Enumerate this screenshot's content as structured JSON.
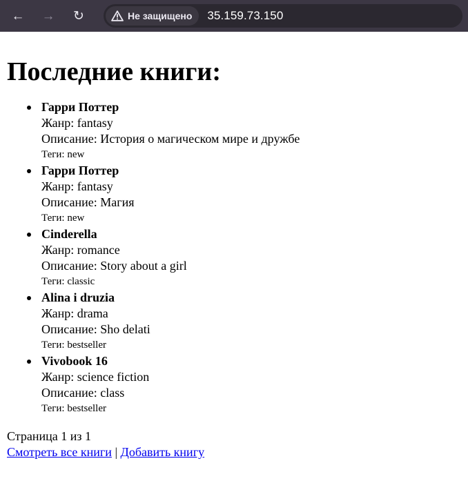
{
  "browser": {
    "security_label": "Не защищено",
    "url": "35.159.73.150",
    "icons": {
      "back": "back-arrow-icon",
      "forward": "forward-arrow-icon",
      "reload": "reload-icon",
      "security": "warning-triangle-icon"
    }
  },
  "page": {
    "heading": "Последние книги:",
    "books": [
      {
        "title": "Гарри Поттер",
        "genre": "Жанр: fantasy",
        "description": "Описание: История о магическом мире и дружбе",
        "tags": "Теги: new"
      },
      {
        "title": "Гарри Поттер",
        "genre": "Жанр: fantasy",
        "description": "Описание: Магия",
        "tags": "Теги: new"
      },
      {
        "title": "Cinderella",
        "genre": "Жанр: romance",
        "description": "Описание: Story about a girl",
        "tags": "Теги: classic"
      },
      {
        "title": "Alina i druzia",
        "genre": "Жанр: drama",
        "description": "Описание: Sho delati",
        "tags": "Теги: bestseller"
      },
      {
        "title": "Vivobook 16",
        "genre": "Жанр: science fiction",
        "description": "Описание: class",
        "tags": "Теги: bestseller"
      }
    ],
    "pagination": "Страница 1 из 1",
    "links": {
      "all_books": "Смотреть все книги",
      "separator": " | ",
      "add_book": "Добавить книгу"
    },
    "colors": {
      "link": "#0000ee",
      "chrome_background": "#3c3744"
    }
  }
}
